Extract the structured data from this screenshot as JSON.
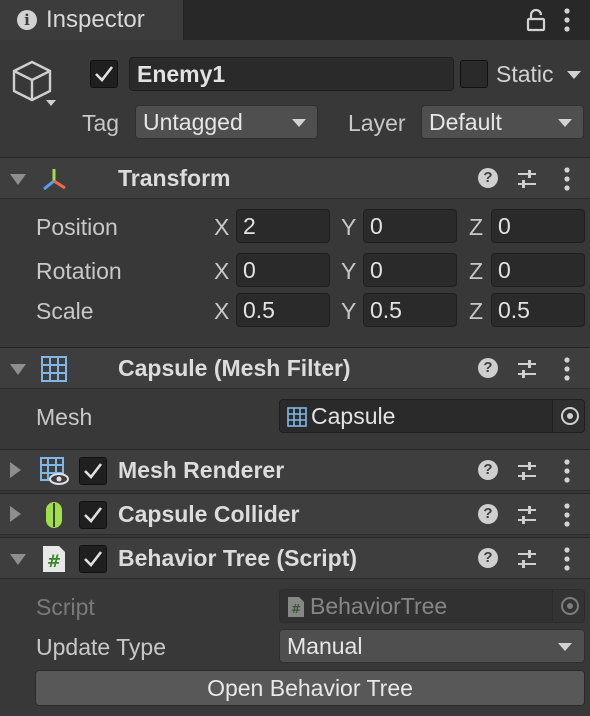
{
  "tab": {
    "title": "Inspector"
  },
  "gameobject": {
    "active": true,
    "name": "Enemy1",
    "static_label": "Static",
    "tag_label": "Tag",
    "tag_value": "Untagged",
    "layer_label": "Layer",
    "layer_value": "Default"
  },
  "transform": {
    "title": "Transform",
    "rows": [
      {
        "label": "Position",
        "x": "2",
        "y": "0",
        "z": "0"
      },
      {
        "label": "Rotation",
        "x": "0",
        "y": "0",
        "z": "0"
      },
      {
        "label": "Scale",
        "x": "0.5",
        "y": "0.5",
        "z": "0.5"
      }
    ],
    "axis_x": "X",
    "axis_y": "Y",
    "axis_z": "Z"
  },
  "mesh_filter": {
    "title": "Capsule (Mesh Filter)",
    "mesh_label": "Mesh",
    "mesh_value": "Capsule"
  },
  "mesh_renderer": {
    "title": "Mesh Renderer",
    "enabled": true
  },
  "capsule_collider": {
    "title": "Capsule Collider",
    "enabled": true
  },
  "behavior_tree": {
    "title": "Behavior Tree (Script)",
    "enabled": true,
    "script_label": "Script",
    "script_value": "BehaviorTree",
    "update_type_label": "Update Type",
    "update_type_value": "Manual",
    "open_button": "Open Behavior Tree"
  },
  "colors": {
    "background": "#383838",
    "header": "#3e3e3e",
    "field": "#2a2a2a",
    "icon_green": "#9fe04a",
    "icon_blue": "#7fb8e8"
  },
  "icons": [
    "info-icon",
    "lock-icon",
    "menu-icon",
    "gameobject-cube-icon",
    "transform-icon",
    "mesh-filter-icon",
    "mesh-renderer-icon",
    "capsule-collider-icon",
    "script-icon",
    "help-icon",
    "preset-icon",
    "object-picker-icon"
  ]
}
